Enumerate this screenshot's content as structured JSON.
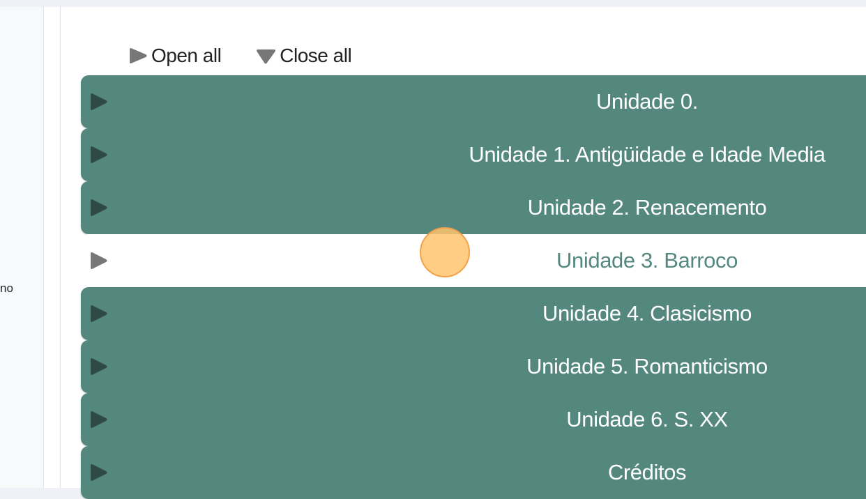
{
  "sidebar": {
    "truncated_text": "no"
  },
  "controls": {
    "open_all_label": "Open all",
    "close_all_label": "Close all"
  },
  "sections": [
    {
      "title": "Unidade 0.",
      "expanded": false
    },
    {
      "title": "Unidade 1. Antigüidade e Idade Media",
      "expanded": false
    },
    {
      "title": "Unidade 2. Renacemento",
      "expanded": false
    },
    {
      "title": "Unidade 3. Barroco",
      "expanded": true
    },
    {
      "title": "Unidade 4. Clasicismo",
      "expanded": false
    },
    {
      "title": "Unidade 5. Romanticismo",
      "expanded": false
    },
    {
      "title": "Unidade 6. S. XX",
      "expanded": false
    },
    {
      "title": "Créditos",
      "expanded": false
    }
  ],
  "colors": {
    "section_bg": "#54887f",
    "section_text": "#ffffff",
    "arrow_dark": "#2f4a45",
    "arrow_grey": "#777777",
    "cursor": "#ffc46e"
  },
  "icons": {
    "open_all": "triangle-right-icon",
    "close_all": "triangle-down-icon",
    "section_toggle": "triangle-right-icon"
  }
}
